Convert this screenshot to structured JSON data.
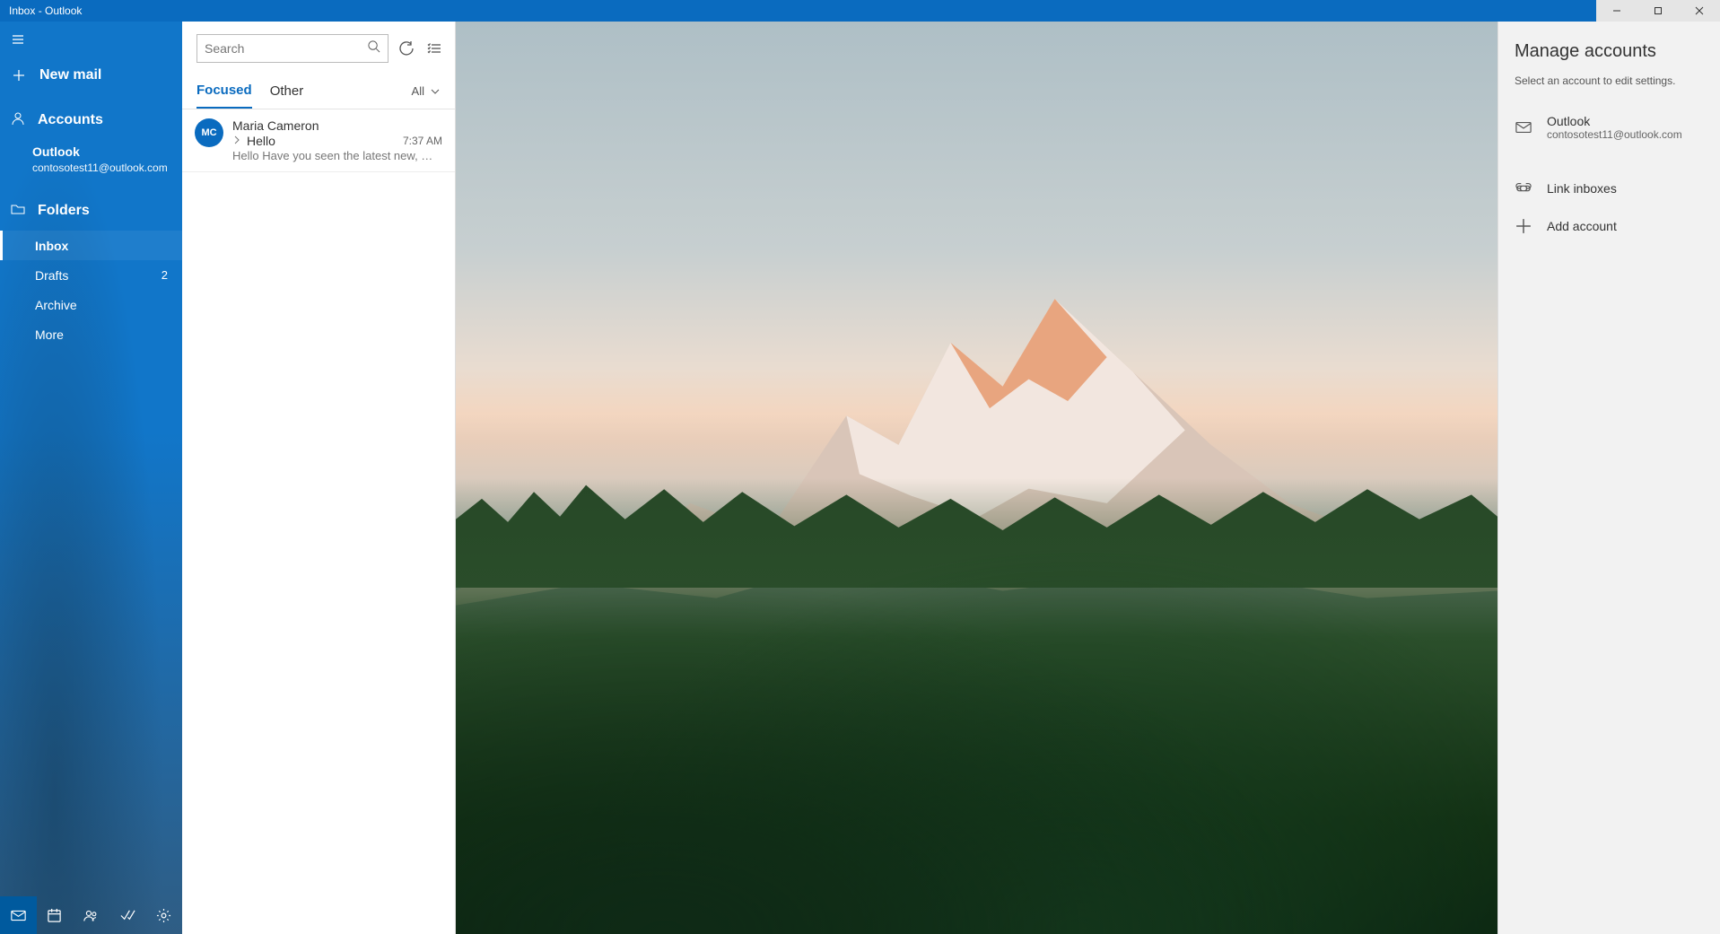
{
  "window": {
    "title": "Inbox - Outlook"
  },
  "sidebar": {
    "new_mail": "New mail",
    "accounts_header": "Accounts",
    "account": {
      "name": "Outlook",
      "email": "contosotest11@outlook.com"
    },
    "folders_header": "Folders",
    "folders": [
      {
        "label": "Inbox",
        "count": ""
      },
      {
        "label": "Drafts",
        "count": "2"
      },
      {
        "label": "Archive",
        "count": ""
      },
      {
        "label": "More",
        "count": ""
      }
    ]
  },
  "msglist": {
    "search_placeholder": "Search",
    "tabs": {
      "focused": "Focused",
      "other": "Other"
    },
    "filter_label": "All",
    "messages": [
      {
        "initials": "MC",
        "sender": "Maria Cameron",
        "subject": "Hello",
        "preview": "Hello Have you seen the latest new, …",
        "time": "7:37 AM"
      }
    ]
  },
  "panel": {
    "title": "Manage accounts",
    "subtitle": "Select an account to edit settings.",
    "account": {
      "name": "Outlook",
      "email": "contosotest11@outlook.com"
    },
    "link_inboxes": "Link inboxes",
    "add_account": "Add account"
  }
}
